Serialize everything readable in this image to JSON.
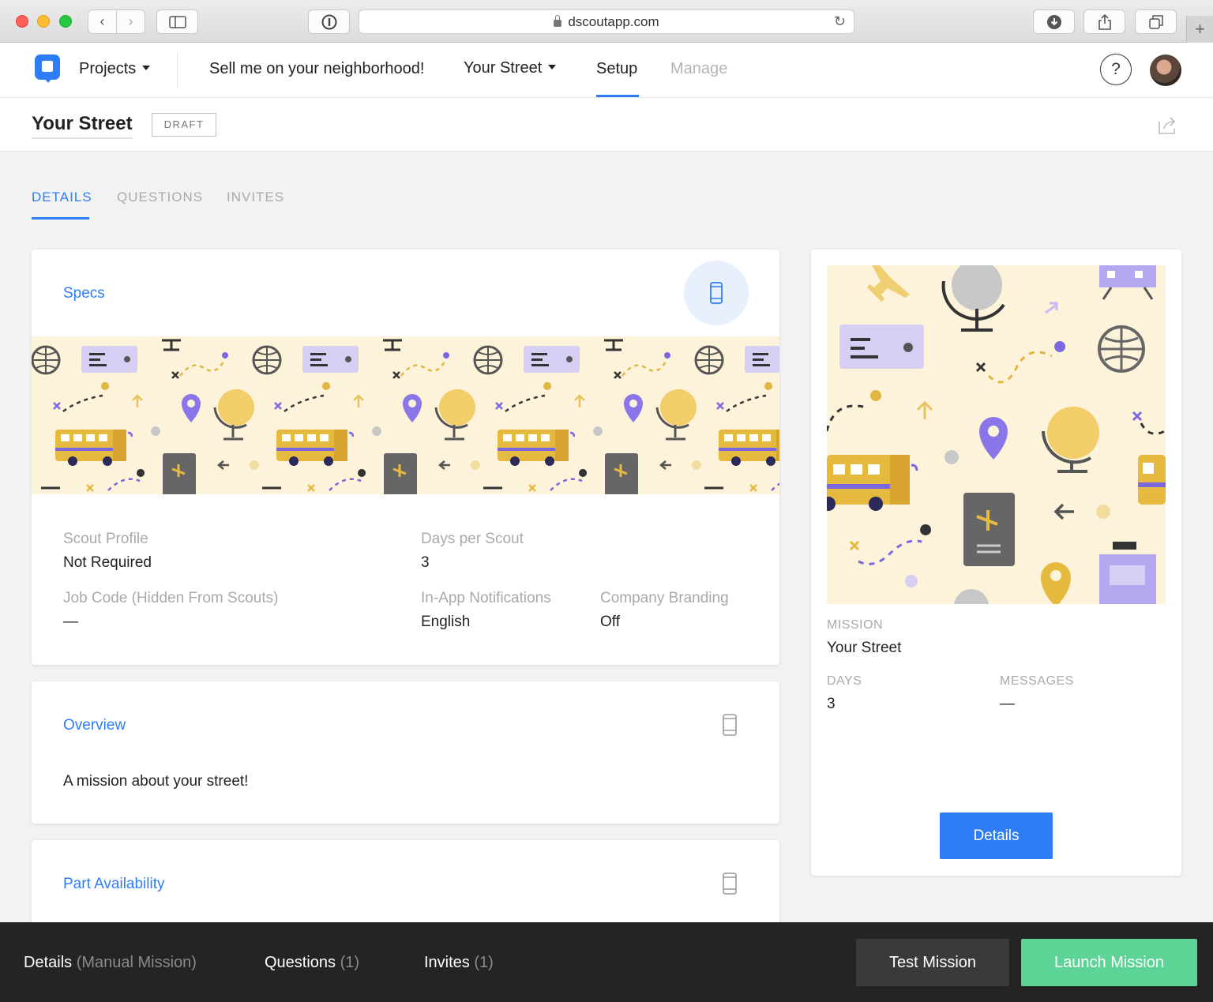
{
  "browser": {
    "url": "dscoutapp.com"
  },
  "nav": {
    "projects_label": "Projects",
    "project_name": "Sell me on your neighborhood!",
    "mission_selector": "Your Street",
    "setup_label": "Setup",
    "manage_label": "Manage",
    "help_label": "?"
  },
  "titlebar": {
    "title": "Your Street",
    "status_badge": "DRAFT"
  },
  "tabs": [
    {
      "label": "DETAILS",
      "active": true
    },
    {
      "label": "QUESTIONS",
      "active": false
    },
    {
      "label": "INVITES",
      "active": false
    }
  ],
  "specs": {
    "title": "Specs",
    "fields": {
      "scout_profile_label": "Scout Profile",
      "scout_profile_value": "Not Required",
      "days_per_scout_label": "Days per Scout",
      "days_per_scout_value": "3",
      "job_code_label": "Job Code (Hidden From Scouts)",
      "job_code_value": "—",
      "notifications_label": "In-App Notifications",
      "notifications_value": "English",
      "branding_label": "Company Branding",
      "branding_value": "Off"
    }
  },
  "overview": {
    "title": "Overview",
    "text": "A mission about your street!"
  },
  "part_availability": {
    "title": "Part Availability"
  },
  "preview": {
    "mission_label": "MISSION",
    "mission_value": "Your Street",
    "days_label": "DAYS",
    "days_value": "3",
    "messages_label": "MESSAGES",
    "messages_value": "—",
    "details_button": "Details"
  },
  "footer": {
    "details_label": "Details",
    "details_sub": "(Manual Mission)",
    "questions_label": "Questions",
    "questions_count": "(1)",
    "invites_label": "Invites",
    "invites_count": "(1)",
    "test_button": "Test Mission",
    "launch_button": "Launch Mission"
  },
  "colors": {
    "accent": "#2f7df6",
    "launch": "#5dd396",
    "footer_bg": "#242424",
    "pattern_bg": "#fdf3da"
  }
}
